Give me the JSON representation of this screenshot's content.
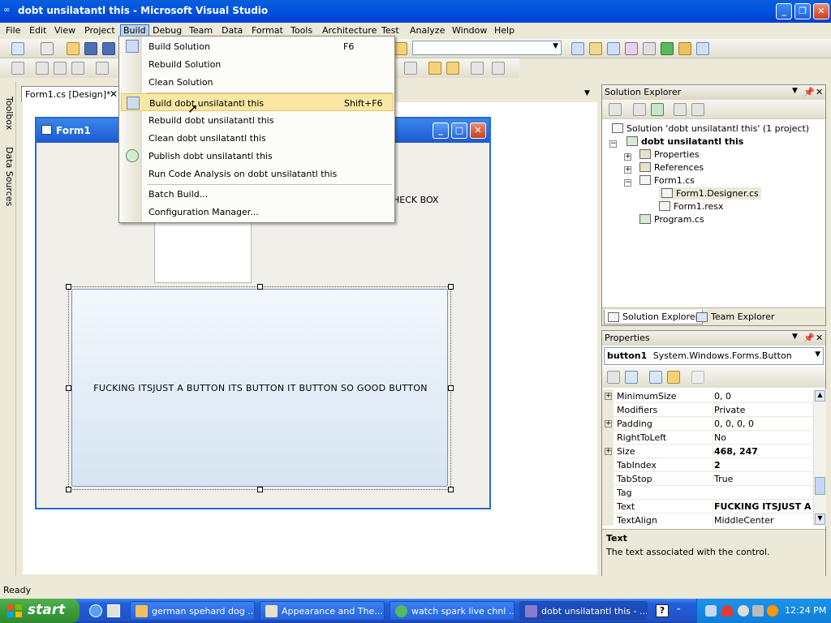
{
  "window": {
    "title": "dobt unsilatantl this - Microsoft Visual Studio"
  },
  "menubar": [
    "File",
    "Edit",
    "View",
    "Project",
    "Build",
    "Debug",
    "Team",
    "Data",
    "Format",
    "Tools",
    "Architecture",
    "Test",
    "Analyze",
    "Window",
    "Help"
  ],
  "left_rail": {
    "toolbox": "Toolbox",
    "data_sources": "Data Sources"
  },
  "doc_tab": {
    "label": "Form1.cs [Design]*"
  },
  "form": {
    "title": "Form1",
    "check_label": "HECK BOX",
    "button_text": "FUCKING ITSJUST A BUTTON ITS BUTTON IT BUTTON SO GOOD BUTTON"
  },
  "build_menu": {
    "items": [
      {
        "label": "Build Solution",
        "shortcut": "F6"
      },
      {
        "label": "Rebuild Solution",
        "shortcut": ""
      },
      {
        "label": "Clean Solution",
        "shortcut": ""
      },
      {
        "label": "Build dobt unsilatantl this",
        "shortcut": "Shift+F6"
      },
      {
        "label": "Rebuild dobt unsilatantl this",
        "shortcut": ""
      },
      {
        "label": "Clean dobt unsilatantl this",
        "shortcut": ""
      },
      {
        "label": "Publish dobt unsilatantl this",
        "shortcut": ""
      },
      {
        "label": "Run Code Analysis on dobt unsilatantl this",
        "shortcut": ""
      },
      {
        "label": "Batch Build...",
        "shortcut": ""
      },
      {
        "label": "Configuration Manager...",
        "shortcut": ""
      }
    ]
  },
  "solution_explorer": {
    "title": "Solution Explorer",
    "tree": {
      "solution": "Solution 'dobt unsilatantl this' (1 project)",
      "project": "dobt unsilatantl this",
      "properties": "Properties",
      "references": "References",
      "form1": "Form1.cs",
      "designer": "Form1.Designer.cs",
      "resx": "Form1.resx",
      "program": "Program.cs"
    },
    "tabs": [
      "Solution Explorer",
      "Team Explorer"
    ]
  },
  "properties": {
    "title": "Properties",
    "object_name": "button1",
    "object_type": "System.Windows.Forms.Button",
    "rows": [
      {
        "name": "MinimumSize",
        "value": "0, 0"
      },
      {
        "name": "Modifiers",
        "value": "Private"
      },
      {
        "name": "Padding",
        "value": "0, 0, 0, 0"
      },
      {
        "name": "RightToLeft",
        "value": "No"
      },
      {
        "name": "Size",
        "value": "468, 247"
      },
      {
        "name": "TabIndex",
        "value": "2"
      },
      {
        "name": "TabStop",
        "value": "True"
      },
      {
        "name": "Tag",
        "value": ""
      },
      {
        "name": "Text",
        "value": "FUCKING ITSJUST A BUTTON ITS BUTTON IT BUTTON SO GOOD BUTTON"
      },
      {
        "name": "TextAlign",
        "value": "MiddleCenter"
      }
    ],
    "desc_title": "Text",
    "desc_text": "The text associated with the control."
  },
  "status": {
    "text": "Ready"
  },
  "taskbar": {
    "start": "start",
    "tasks": [
      "german spehard dog ...",
      "Appearance and The...",
      "watch spark live chnl ...",
      "dobt unsilatantl this - ..."
    ],
    "clock": "12:24 PM"
  }
}
